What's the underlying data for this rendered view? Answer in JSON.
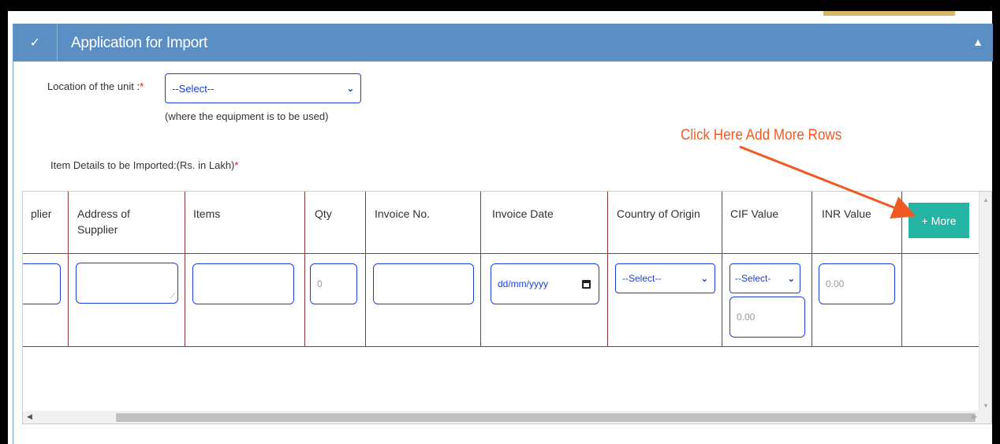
{
  "panel": {
    "title": "Application for Import"
  },
  "location": {
    "label": "Location of the unit :",
    "required_mark": "*",
    "select_value": "--Select--",
    "help": "(where the equipment is to be used)"
  },
  "annotation": {
    "text": "Click Here Add More Rows",
    "color": "#f05a22"
  },
  "items": {
    "label": "Item Details to be Imported:(Rs. in Lakh)",
    "required_mark": "*"
  },
  "table": {
    "columns": [
      "plier",
      "Address of Supplier",
      "Items",
      "Qty",
      "Invoice No.",
      "Invoice Date",
      "Country of Origin",
      "CIF Value",
      "INR Value"
    ],
    "more_button": "+ More",
    "row": {
      "qty_placeholder": "0",
      "date_placeholder": "dd/mm/yyyy",
      "country_select": "--Select--",
      "cif_select": "--Select-",
      "cif_value_placeholder": "0.00",
      "inr_value_placeholder": "0.00"
    }
  },
  "colors": {
    "header_bg": "#5b8fc3",
    "accent_blue": "#1a3fd9",
    "button_teal": "#26b5a5",
    "table_line": "#8b3a3a"
  }
}
